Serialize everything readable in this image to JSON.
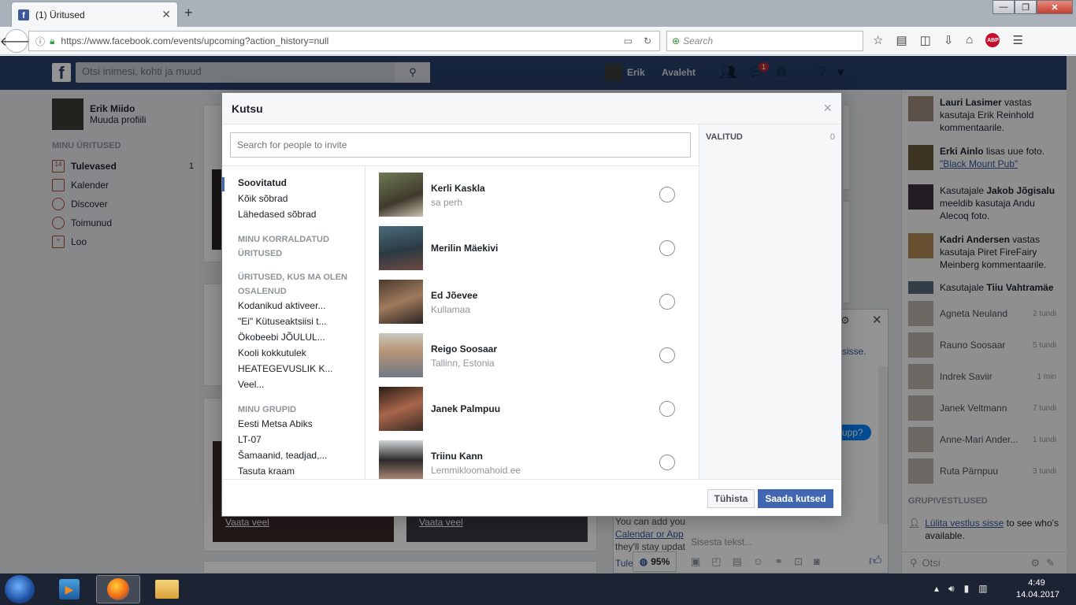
{
  "browser": {
    "tab_title": "(1) Üritused",
    "url": "https://www.facebook.com/events/upcoming?action_history=null",
    "search_placeholder": "Search",
    "abp": "ABP"
  },
  "fb": {
    "search_placeholder": "Otsi inimesi, kohti ja muud",
    "user_name": "Erik",
    "home": "Avaleht",
    "messages_badge": "1",
    "profile_name": "Erik Miido",
    "edit_profile": "Muuda profiili",
    "my_events": "MINU ÜRITUSED",
    "nav": [
      {
        "label": "Tulevased",
        "count": "1",
        "icon": "14"
      },
      {
        "label": "Kalender"
      },
      {
        "label": "Discover"
      },
      {
        "label": "Toimunud"
      },
      {
        "label": "Loo"
      }
    ],
    "see_more_1": "Vaata veel",
    "see_more_2": "Vaata veel"
  },
  "ticker": [
    {
      "name": "Lauri Lasimer",
      "text": " vastas kasutaja Erik Reinhold kommentaarile."
    },
    {
      "name": "Erki Ainlo",
      "text": " lisas uue foto.",
      "link": "\"Black Mount Pub\""
    },
    {
      "pre": "Kasutajale ",
      "name": "Jakob Jõgisalu",
      "text": " meeldib kasutaja Andu Alecoq foto."
    },
    {
      "name": "Kadri Andersen",
      "text": " vastas kasutaja Piret FireFairy Meinberg kommentaarile."
    },
    {
      "pre": "Kasutajale ",
      "name": "Tiiu Vahtramäe",
      "text": ""
    }
  ],
  "chat": {
    "contacts": [
      {
        "name": "Agneta Neuland",
        "time": "2 tundi"
      },
      {
        "name": "Rauno Soosaar",
        "time": "5 tundi"
      },
      {
        "name": "Indrek Saviir",
        "time": "1 min"
      },
      {
        "name": "Janek Veltmann",
        "time": "7 tundi"
      },
      {
        "name": "Anne-Mari Ander...",
        "time": "1 tundi"
      },
      {
        "name": "Ruta Pärnpuu",
        "time": "3 tundi"
      }
    ],
    "group_header": "GRUPIVESTLUSED",
    "turn_on": "Lülita vestlus sisse",
    "turn_on_rest": " to see who's available.",
    "search_placeholder": "Otsi",
    "bubble": "upp?",
    "sisse": "sisse.",
    "type_placeholder": "Sisesta tekst...",
    "zoom": "95%",
    "cal_1": "You can add you",
    "cal_2": "Calendar or App",
    "cal_3": "they'll stay updat",
    "cal_4": "Tule"
  },
  "modal": {
    "title": "Kutsu",
    "search_placeholder": "Search for people to invite",
    "filters": [
      {
        "label": "Soovitatud",
        "selected": true
      },
      {
        "label": "Kõik sõbrad"
      },
      {
        "label": "Lähedased sõbrad"
      }
    ],
    "organized_header": "MINU KORRALDATUD ÜRITUSED",
    "attended_header": "ÜRITUSED, KUS MA OLEN OSALENUD",
    "attended": [
      "Kodanikud aktiveer...",
      "\"Ei\" Kütuseaktsiisi t...",
      "Ökobeebi JÕULUL...",
      "Kooli kokkutulek",
      "HEATEGEVUSLIK K...",
      "Veel..."
    ],
    "groups_header": "MINU GRUPID",
    "groups": [
      "Eesti Metsa Abiks",
      "LT-07",
      "Šamaanid, teadjad,...",
      "Tasuta kraam"
    ],
    "people": [
      {
        "name": "Kerli Kaskla",
        "sub": "sa perh"
      },
      {
        "name": "Merilin Mäekivi",
        "sub": ""
      },
      {
        "name": "Ed Jõevee",
        "sub": "Kullamaa"
      },
      {
        "name": "Reigo Soosaar",
        "sub": "Tallinn, Estonia"
      },
      {
        "name": "Janek Palmpuu",
        "sub": ""
      },
      {
        "name": "Triinu Kann",
        "sub": "Lemmikloomahoid.ee"
      }
    ],
    "selected_label": "VALITUD",
    "selected_count": "0",
    "cancel": "Tühista",
    "send": "Saada kutsed"
  },
  "taskbar": {
    "time": "4:49",
    "date": "14.04.2017"
  }
}
